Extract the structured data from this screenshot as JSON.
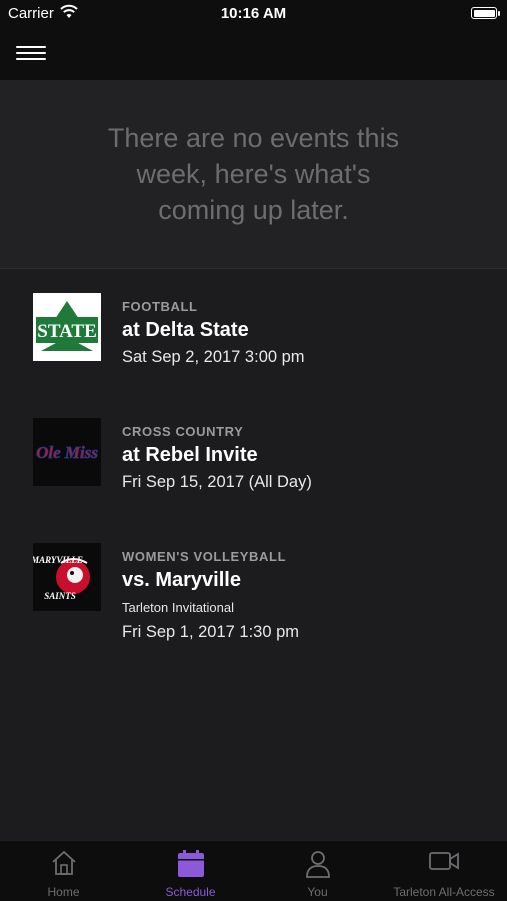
{
  "status_bar": {
    "carrier": "Carrier",
    "time": "10:16 AM"
  },
  "banner": {
    "message": "There are no events this week, here's what's coming up later."
  },
  "events": [
    {
      "sport": "FOOTBALL",
      "title": "at Delta State",
      "subtitle": "",
      "date": "Sat Sep 2, 2017 3:00 pm"
    },
    {
      "sport": "CROSS COUNTRY",
      "title": "at Rebel Invite",
      "subtitle": "",
      "date": "Fri Sep 15, 2017 (All Day)"
    },
    {
      "sport": "WOMEN'S VOLLEYBALL",
      "title": "vs. Maryville",
      "subtitle": "Tarleton Invitational",
      "date": "Fri Sep 1, 2017 1:30 pm"
    }
  ],
  "logos": {
    "delta_state": "STATE",
    "ole_miss": "Ole Miss",
    "maryville_top": "MARYVILLE",
    "maryville_bottom": "SAINTS"
  },
  "tabs": [
    {
      "label": "Home",
      "icon": "home-icon"
    },
    {
      "label": "Schedule",
      "icon": "calendar-icon"
    },
    {
      "label": "You",
      "icon": "person-icon"
    },
    {
      "label": "Tarleton All-Access",
      "icon": "video-camera-icon"
    }
  ],
  "colors": {
    "accent": "#8c59d9",
    "background": "#1c1c1e",
    "banner": "#222224",
    "bar": "#0e0e0f"
  }
}
